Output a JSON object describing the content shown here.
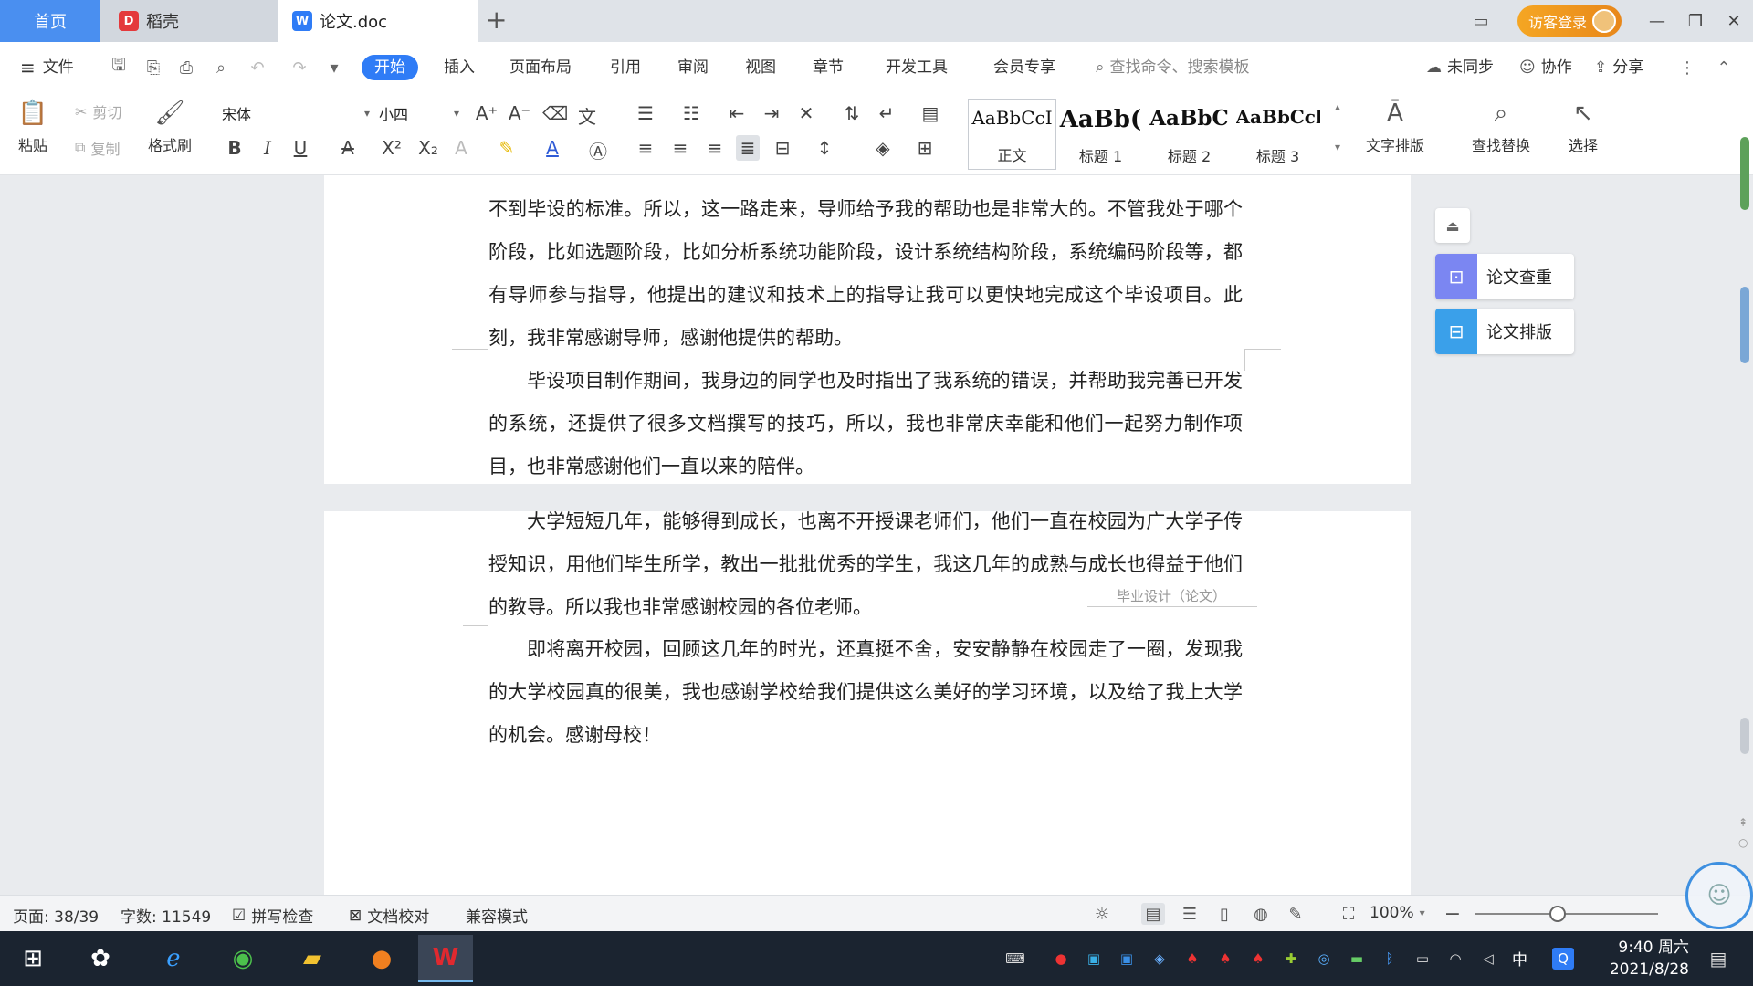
{
  "tabs": {
    "home": "首页",
    "daoke": "稻壳",
    "doc": "论文.doc"
  },
  "titlebar": {
    "guest_login": "访客登录"
  },
  "menu": {
    "file": "文件",
    "items": [
      "开始",
      "插入",
      "页面布局",
      "引用",
      "审阅",
      "视图",
      "章节",
      "开发工具",
      "会员专享"
    ],
    "search_placeholder": "查找命令、搜索模板",
    "not_synced": "未同步",
    "collaborate": "协作",
    "share": "分享"
  },
  "ribbon": {
    "paste": "粘贴",
    "cut": "剪切",
    "copy": "复制",
    "format_painter": "格式刷",
    "font_name": "宋体",
    "font_size": "小四",
    "styles": [
      {
        "sample": "AaBbCcI",
        "name": "正文"
      },
      {
        "sample": "AaBb(",
        "name": "标题 1"
      },
      {
        "sample": "AaBbC",
        "name": "标题 2"
      },
      {
        "sample": "AaBbCcl",
        "name": "标题 3"
      }
    ],
    "text_layout": "文字排版",
    "find_replace": "查找替换",
    "select": "选择"
  },
  "document": {
    "page1_paragraphs": [
      "不到毕设的标准。所以，这一路走来，导师给予我的帮助也是非常大的。不管我处于哪个阶段，比如选题阶段，比如分析系统功能阶段，设计系统结构阶段，系统编码阶段等，都有导师参与指导，他提出的建议和技术上的指导让我可以更快地完成这个毕设项目。此刻，我非常感谢导师，感谢他提供的帮助。",
      "毕设项目制作期间，我身边的同学也及时指出了我系统的错误，并帮助我完善已开发的系统，还提供了很多文档撰写的技巧，所以，我也非常庆幸能和他们一起努力制作项目，也非常感谢他们一直以来的陪伴。"
    ],
    "page2_paragraphs": [
      "大学短短几年，能够得到成长，也离不开授课老师们，他们一直在校园为广大学子传授知识，用他们毕生所学，教出一批批优秀的学生，我这几年的成熟与成长也得益于他们的教导。所以我也非常感谢校园的各位老师。",
      "即将离开校园，回顾这几年的时光，还真挺不舍，安安静静在校园走了一圈，发现我的大学校园真的很美，我也感谢学校给我们提供这么美好的学习环境，以及给了我上大学的机会。感谢母校！"
    ],
    "header_note": "毕业设计（论文）"
  },
  "side_panel": {
    "check": "论文查重",
    "layout": "论文排版"
  },
  "status": {
    "page": "页面: 38/39",
    "words": "字数: 11549",
    "spell_check": "拼写检查",
    "proofread": "文档校对",
    "compat_mode": "兼容模式",
    "zoom": "100%",
    "zoom_level": 0.45
  },
  "taskbar": {
    "ime": "中",
    "time": "9:40 周六",
    "date": "2021/8/28"
  },
  "colors": {
    "accent": "#2f7cf6",
    "home_tab": "#4a8ff0",
    "login": "#f0a01e",
    "wps_red": "#d9272e"
  }
}
